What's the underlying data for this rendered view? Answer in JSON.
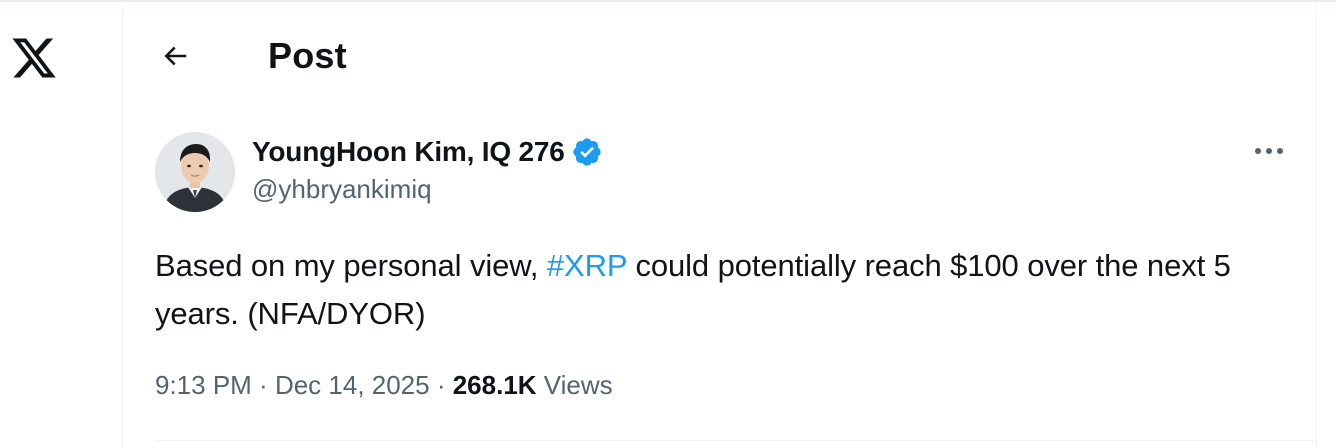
{
  "app": {
    "logo_icon": "x-logo-icon"
  },
  "header": {
    "back_icon": "arrow-left-icon",
    "title": "Post"
  },
  "post": {
    "author": {
      "display_name": "YoungHoon Kim, IQ 276",
      "handle": "@yhbryankimiq",
      "verified": true,
      "verified_icon": "verified-badge-icon",
      "verified_color": "#1d9bf0"
    },
    "more_icon": "more-horizontal-icon",
    "text": {
      "before_hashtag": "Based on my personal view, ",
      "hashtag": "#XRP",
      "after_hashtag": " could potentially reach $100 over the next 5 years. (NFA/DYOR)"
    },
    "meta": {
      "time": "9:13 PM",
      "separator": " · ",
      "date": "Dec 14, 2025",
      "views_count": "268.1K",
      "views_label": " Views"
    }
  },
  "colors": {
    "text_primary": "#0f1419",
    "text_secondary": "#536471",
    "link": "#1d9bf0",
    "divider": "#eff3f4"
  }
}
